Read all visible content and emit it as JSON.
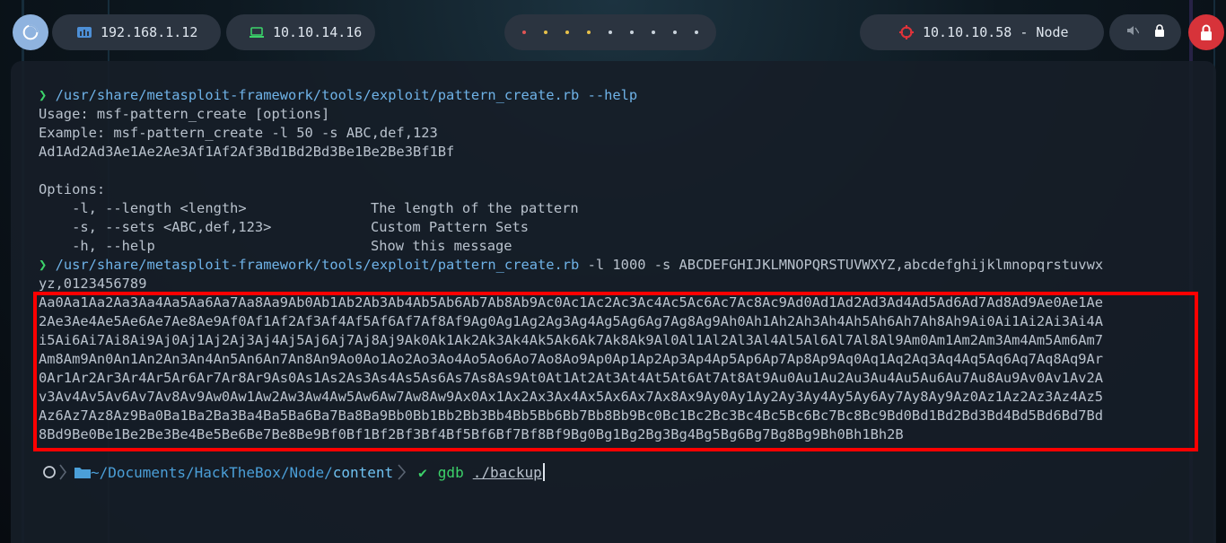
{
  "topbar": {
    "ip_local": "192.168.1.12",
    "ip_vpn": "10.10.14.16",
    "target": "10.10.10.58 - Node",
    "colors": {
      "pill": "#2b3440",
      "power": "#d7333a",
      "logo": "#8fb3df"
    }
  },
  "terminal": {
    "prompt_symbol": "❯",
    "cmd1": "/usr/share/metasploit-framework/tools/exploit/pattern_create.rb --help",
    "usage": "Usage: msf-pattern_create [options]",
    "example": "Example: msf-pattern_create -l 50 -s ABC,def,123",
    "example_output": "Ad1Ad2Ad3Ae1Ae2Ae3Af1Af2Af3Bd1Bd2Bd3Be1Be2Be3Bf1Bf",
    "options_header": "Options:",
    "options": [
      {
        "flag": "    -l, --length <length>",
        "desc": "The length of the pattern"
      },
      {
        "flag": "    -s, --sets <ABC,def,123>",
        "desc": "Custom Pattern Sets"
      },
      {
        "flag": "    -h, --help",
        "desc": "Show this message"
      }
    ],
    "cmd2_path": "/usr/share/metasploit-framework/tools/exploit/pattern_create.rb",
    "cmd2_args": "-l 1000 -s ABCDEFGHIJKLMNOPQRSTUVWXYZ,abcdefghijklmnopqrstuvwx",
    "cmd2_wrap": "yz,0123456789",
    "pattern_lines": [
      "Aa0Aa1Aa2Aa3Aa4Aa5Aa6Aa7Aa8Aa9Ab0Ab1Ab2Ab3Ab4Ab5Ab6Ab7Ab8Ab9Ac0Ac1Ac2Ac3Ac4Ac5Ac6Ac7Ac8Ac9Ad0Ad1Ad2Ad3Ad4Ad5Ad6Ad7Ad8Ad9Ae0Ae1Ae",
      "2Ae3Ae4Ae5Ae6Ae7Ae8Ae9Af0Af1Af2Af3Af4Af5Af6Af7Af8Af9Ag0Ag1Ag2Ag3Ag4Ag5Ag6Ag7Ag8Ag9Ah0Ah1Ah2Ah3Ah4Ah5Ah6Ah7Ah8Ah9Ai0Ai1Ai2Ai3Ai4A",
      "i5Ai6Ai7Ai8Ai9Aj0Aj1Aj2Aj3Aj4Aj5Aj6Aj7Aj8Aj9Ak0Ak1Ak2Ak3Ak4Ak5Ak6Ak7Ak8Ak9Al0Al1Al2Al3Al4Al5Al6Al7Al8Al9Am0Am1Am2Am3Am4Am5Am6Am7",
      "Am8Am9An0An1An2An3An4An5An6An7An8An9Ao0Ao1Ao2Ao3Ao4Ao5Ao6Ao7Ao8Ao9Ap0Ap1Ap2Ap3Ap4Ap5Ap6Ap7Ap8Ap9Aq0Aq1Aq2Aq3Aq4Aq5Aq6Aq7Aq8Aq9Ar",
      "0Ar1Ar2Ar3Ar4Ar5Ar6Ar7Ar8Ar9As0As1As2As3As4As5As6As7As8As9At0At1At2At3At4At5At6At7At8At9Au0Au1Au2Au3Au4Au5Au6Au7Au8Au9Av0Av1Av2A",
      "v3Av4Av5Av6Av7Av8Av9Aw0Aw1Aw2Aw3Aw4Aw5Aw6Aw7Aw8Aw9Ax0Ax1Ax2Ax3Ax4Ax5Ax6Ax7Ax8Ax9Ay0Ay1Ay2Ay3Ay4Ay5Ay6Ay7Ay8Ay9Az0Az1Az2Az3Az4Az5",
      "Az6Az7Az8Az9Ba0Ba1Ba2Ba3Ba4Ba5Ba6Ba7Ba8Ba9Bb0Bb1Bb2Bb3Bb4Bb5Bb6Bb7Bb8Bb9Bc0Bc1Bc2Bc3Bc4Bc5Bc6Bc7Bc8Bc9Bd0Bd1Bd2Bd3Bd4Bd5Bd6Bd7Bd",
      "8Bd9Be0Be1Be2Be3Be4Be5Be6Be7Be8Be9Bf0Bf1Bf2Bf3Bf4Bf5Bf6Bf7Bf8Bf9Bg0Bg1Bg2Bg3Bg4Bg5Bg6Bg7Bg8Bg9Bh0Bh1Bh2B"
    ],
    "highlight_color": "#ff0000"
  },
  "prompt": {
    "path_prefix": "~/Documents/HackTheBox/Node/",
    "path_dir": "content",
    "command": "gdb",
    "argument": "./backup"
  }
}
